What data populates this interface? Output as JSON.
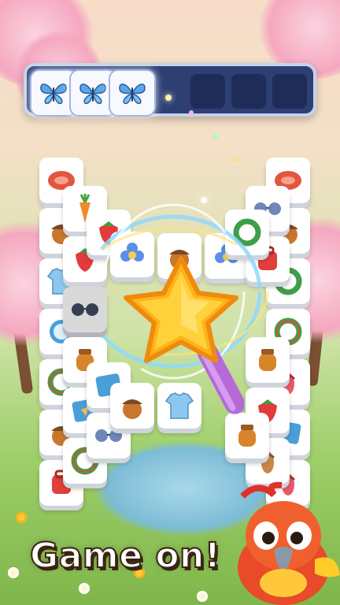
{
  "game": {
    "slot_bar": {
      "slots_total": 7,
      "filled": [
        "butterfly-icon",
        "butterfly-icon",
        "butterfly-icon"
      ]
    },
    "banner_text": "Game on!",
    "booster": "magic-wand-star",
    "tile_icons": [
      "steak",
      "carrot",
      "strawberry",
      "acorn",
      "shirt",
      "blue-fish",
      "compass",
      "donut-ring",
      "honey-jar",
      "sunglasses",
      "backpack",
      "sandals",
      "blue-flower"
    ]
  },
  "colors": {
    "slot_bar": "#2d3f73",
    "tile_face": "#ffffff",
    "star": "#ffd23c",
    "wand_stick": "#b56ad8",
    "banner_text": "#ffffff"
  }
}
